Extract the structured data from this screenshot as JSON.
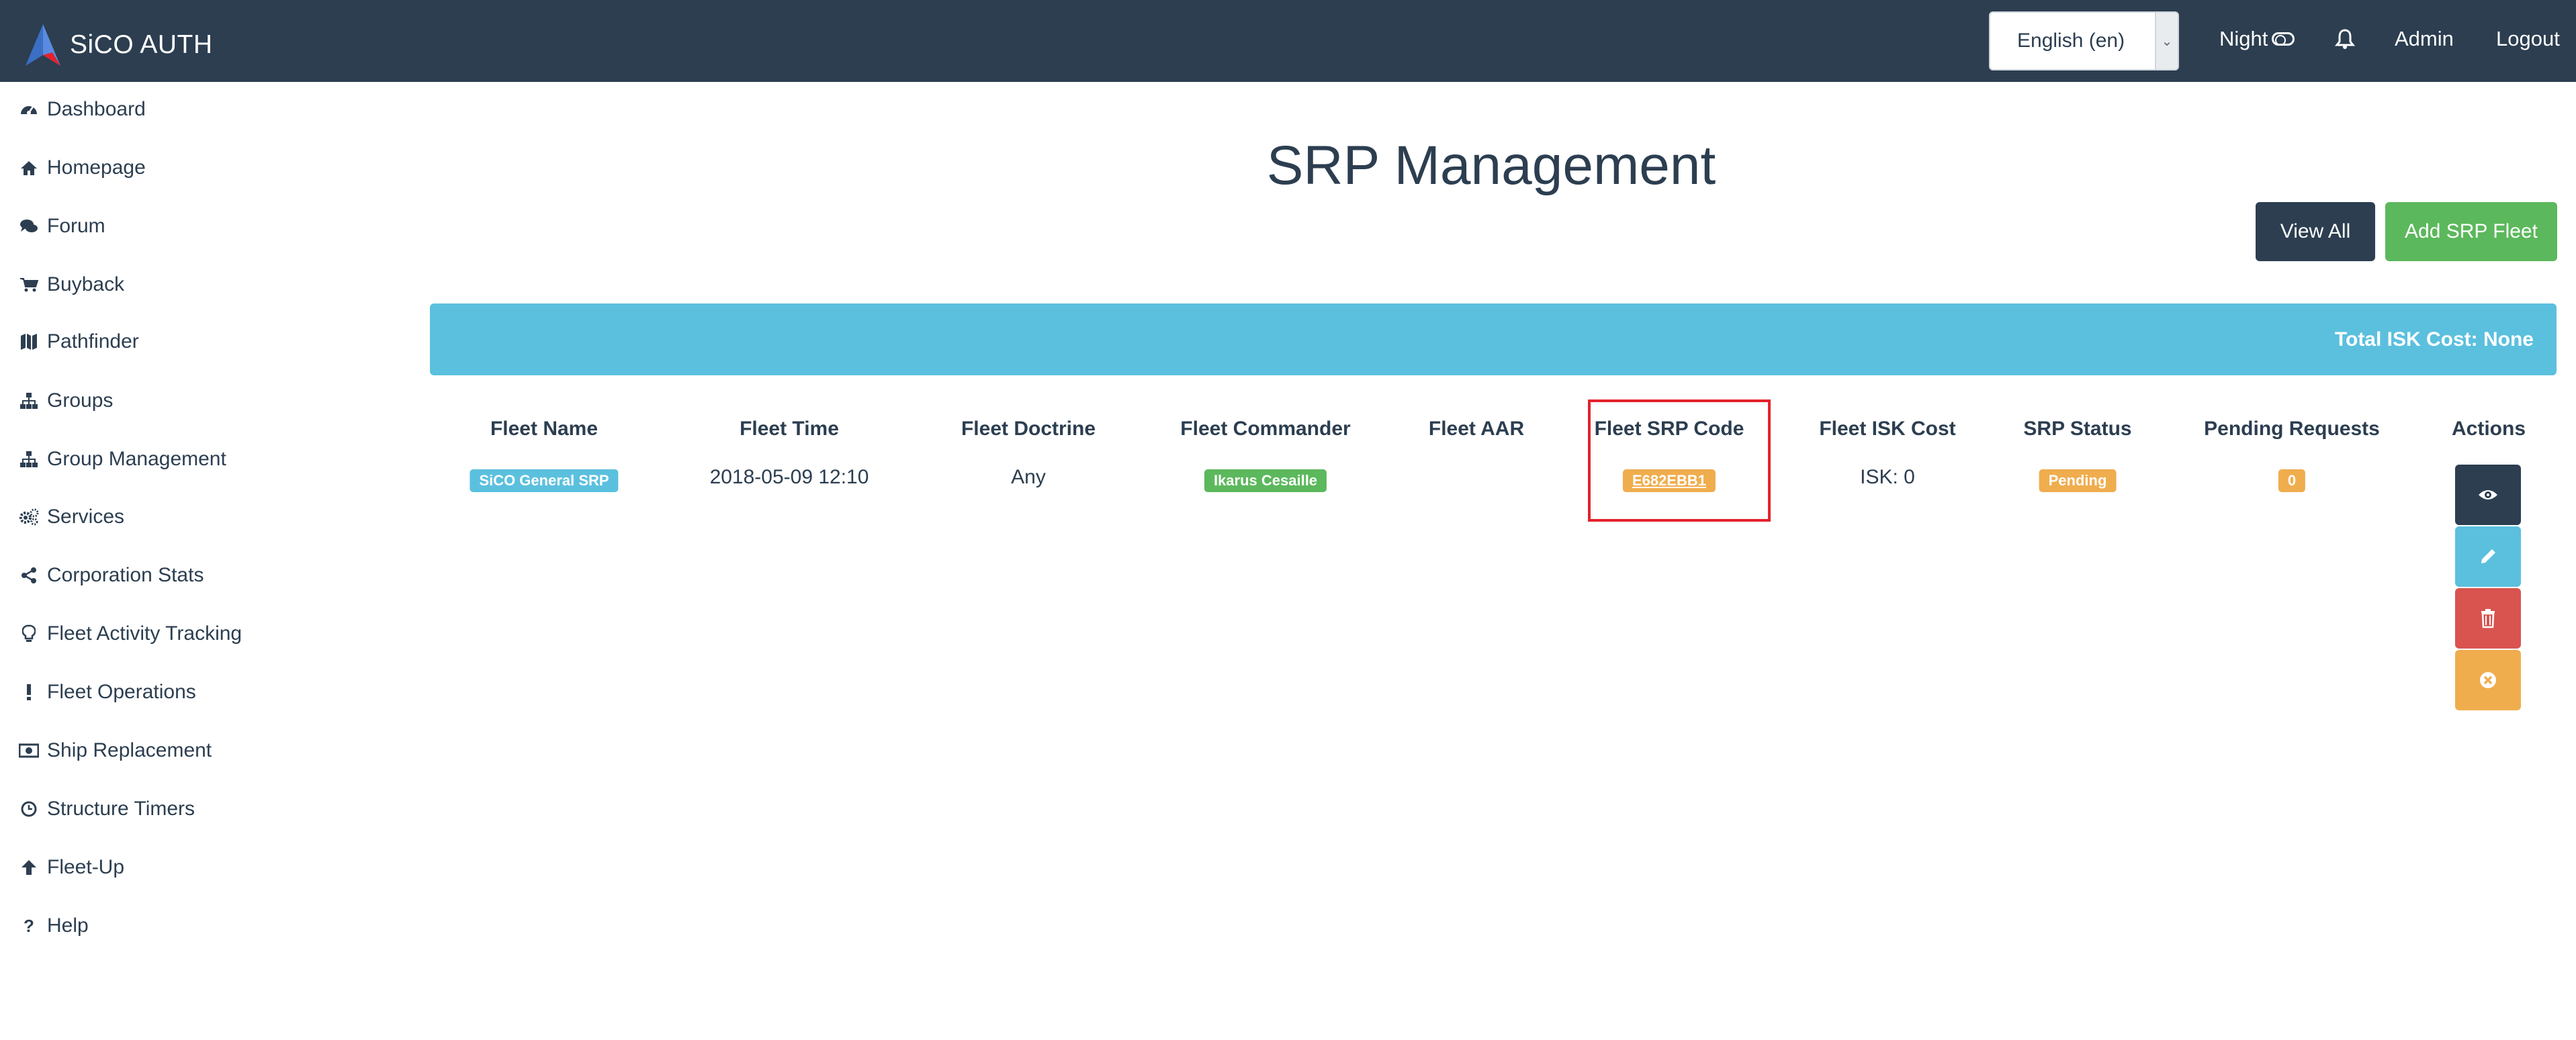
{
  "navbar": {
    "brand": "SiCO AUTH",
    "language": "English (en)",
    "night_label": "Night",
    "admin_label": "Admin",
    "logout_label": "Logout"
  },
  "sidebar": {
    "items": [
      {
        "label": "Dashboard",
        "icon": "dashboard-icon"
      },
      {
        "label": "Homepage",
        "icon": "home-icon"
      },
      {
        "label": "Forum",
        "icon": "comments-icon"
      },
      {
        "label": "Buyback",
        "icon": "cart-icon"
      },
      {
        "label": "Pathfinder",
        "icon": "map-icon"
      },
      {
        "label": "Groups",
        "icon": "sitemap-icon"
      },
      {
        "label": "Group Management",
        "icon": "sitemap-icon"
      },
      {
        "label": "Services",
        "icon": "cogs-icon"
      },
      {
        "label": "Corporation Stats",
        "icon": "share-icon"
      },
      {
        "label": "Fleet Activity Tracking",
        "icon": "lightbulb-icon"
      },
      {
        "label": "Fleet Operations",
        "icon": "exclamation-icon"
      },
      {
        "label": "Ship Replacement",
        "icon": "money-icon"
      },
      {
        "label": "Structure Timers",
        "icon": "clock-icon"
      },
      {
        "label": "Fleet-Up",
        "icon": "arrow-up-icon"
      },
      {
        "label": "Help",
        "icon": "question-icon"
      }
    ]
  },
  "main": {
    "title": "SRP Management",
    "view_all_label": "View All",
    "add_fleet_label": "Add SRP Fleet",
    "total_cost": "Total ISK Cost: None",
    "table": {
      "headers": [
        "Fleet Name",
        "Fleet Time",
        "Fleet Doctrine",
        "Fleet Commander",
        "Fleet AAR",
        "Fleet SRP Code",
        "Fleet ISK Cost",
        "SRP Status",
        "Pending Requests",
        "Actions"
      ],
      "row": {
        "fleet_name": "SiCO General SRP",
        "fleet_time": "2018-05-09 12:10",
        "fleet_doctrine": "Any",
        "fleet_commander": "Ikarus Cesaille",
        "fleet_aar": "",
        "srp_code": "E682EBB1",
        "isk_cost": "ISK: 0",
        "srp_status": "Pending",
        "pending_requests": "0"
      }
    },
    "actions": [
      {
        "name": "view",
        "icon": "eye-icon",
        "color": "#2c3e50"
      },
      {
        "name": "edit",
        "icon": "pencil-icon",
        "color": "#5bc0de"
      },
      {
        "name": "delete",
        "icon": "trash-icon",
        "color": "#d9534f"
      },
      {
        "name": "cancel",
        "icon": "close-circle-icon",
        "color": "#f0ad4e"
      }
    ]
  },
  "colors": {
    "navbar": "#2c3e50",
    "info": "#5bc0de",
    "success": "#5cb85c",
    "warning": "#f0ad4e",
    "danger": "#d9534f",
    "highlight": "#e3222c"
  }
}
